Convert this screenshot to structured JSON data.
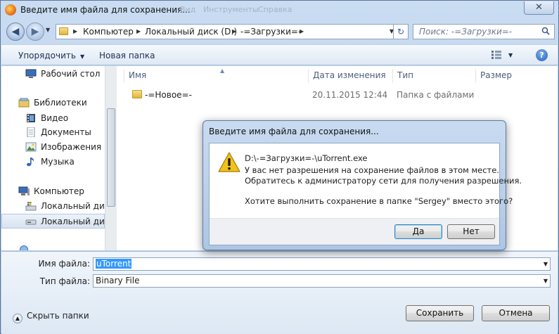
{
  "window": {
    "title": "Введите имя файла для сохранения...",
    "ghost_menu": [
      "Вид",
      "Инструменты",
      "Справка"
    ],
    "close_glyph": "✕"
  },
  "navbar": {
    "crumbs": [
      "Компьютер",
      "Локальный диск (D:)",
      "-=Загрузки=-"
    ],
    "search_placeholder": "Поиск: -=Загрузки=-"
  },
  "toolbar": {
    "organize": "Упорядочить",
    "new_folder": "Новая папка"
  },
  "sidebar": {
    "items": [
      {
        "label": "Рабочий стол",
        "icon": "desktop-icon"
      },
      {
        "label": "Библиотеки",
        "icon": "libraries-icon"
      },
      {
        "label": "Видео",
        "icon": "video-icon"
      },
      {
        "label": "Документы",
        "icon": "documents-icon"
      },
      {
        "label": "Изображения",
        "icon": "pictures-icon"
      },
      {
        "label": "Музыка",
        "icon": "music-icon"
      },
      {
        "label": "Компьютер",
        "icon": "computer-icon"
      },
      {
        "label": "Локальный диск",
        "icon": "drive-c-icon"
      },
      {
        "label": "Локальный диск",
        "icon": "drive-d-icon"
      }
    ]
  },
  "files": {
    "columns": [
      "Имя",
      "Дата изменения",
      "Тип",
      "Размер"
    ],
    "rows": [
      {
        "name": "-=Новое=-",
        "modified": "20.11.2015 12:44",
        "type": "Папка с файлами",
        "size": ""
      }
    ]
  },
  "form": {
    "filename_label": "Имя файла:",
    "filename_value": "uTorrent",
    "filetype_label": "Тип файла:",
    "filetype_value": "Binary File",
    "hide_folders": "Скрыть папки",
    "save": "Сохранить",
    "cancel": "Отмена"
  },
  "dialog": {
    "title": "Введите имя файла для сохранения...",
    "path": "D:\\-=Загрузки=-\\uTorrent.exe",
    "line1": "У вас нет разрешения на сохранение файлов в этом месте.",
    "line2": "Обратитесь к администратору сети для получения разрешения.",
    "question": "Хотите выполнить сохранение в папке \"Sergey\" вместо этого?",
    "yes": "Да",
    "no": "Нет"
  },
  "colors": {
    "accent": "#3399ff",
    "warning": "#f2c21b"
  }
}
